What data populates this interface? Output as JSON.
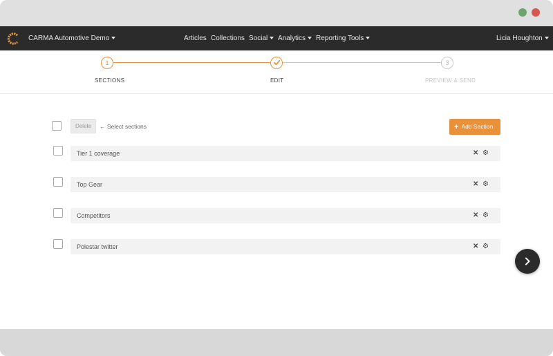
{
  "window": {
    "controls": {
      "green_color": "#6aa76e",
      "red_color": "#d9534f"
    }
  },
  "navbar": {
    "logo_icon": "carma-c-logo",
    "brand": "CARMA Automotive Demo",
    "items": [
      {
        "label": "Articles",
        "dropdown": false
      },
      {
        "label": "Collections",
        "dropdown": false
      },
      {
        "label": "Social",
        "dropdown": true
      },
      {
        "label": "Analytics",
        "dropdown": true
      },
      {
        "label": "Reporting Tools",
        "dropdown": true
      }
    ],
    "user": "Licia Houghton"
  },
  "stepper": {
    "steps": [
      {
        "number": "1",
        "label": "SECTIONS",
        "state": "complete"
      },
      {
        "number": "",
        "label": "EDIT",
        "state": "current",
        "icon": "checkmark-icon"
      },
      {
        "number": "3",
        "label": "PREVIEW & SEND",
        "state": "upcoming"
      }
    ],
    "accent_color": "#e8913a"
  },
  "toolbar": {
    "delete_label": "Delete",
    "hint": "← Select sections",
    "add_label": "Add Section"
  },
  "sections": [
    {
      "name": "Tier 1 coverage"
    },
    {
      "name": "Top Gear"
    },
    {
      "name": "Competitors"
    },
    {
      "name": "Polestar twitter"
    }
  ],
  "next_button": {
    "icon": "chevron-right-icon"
  }
}
